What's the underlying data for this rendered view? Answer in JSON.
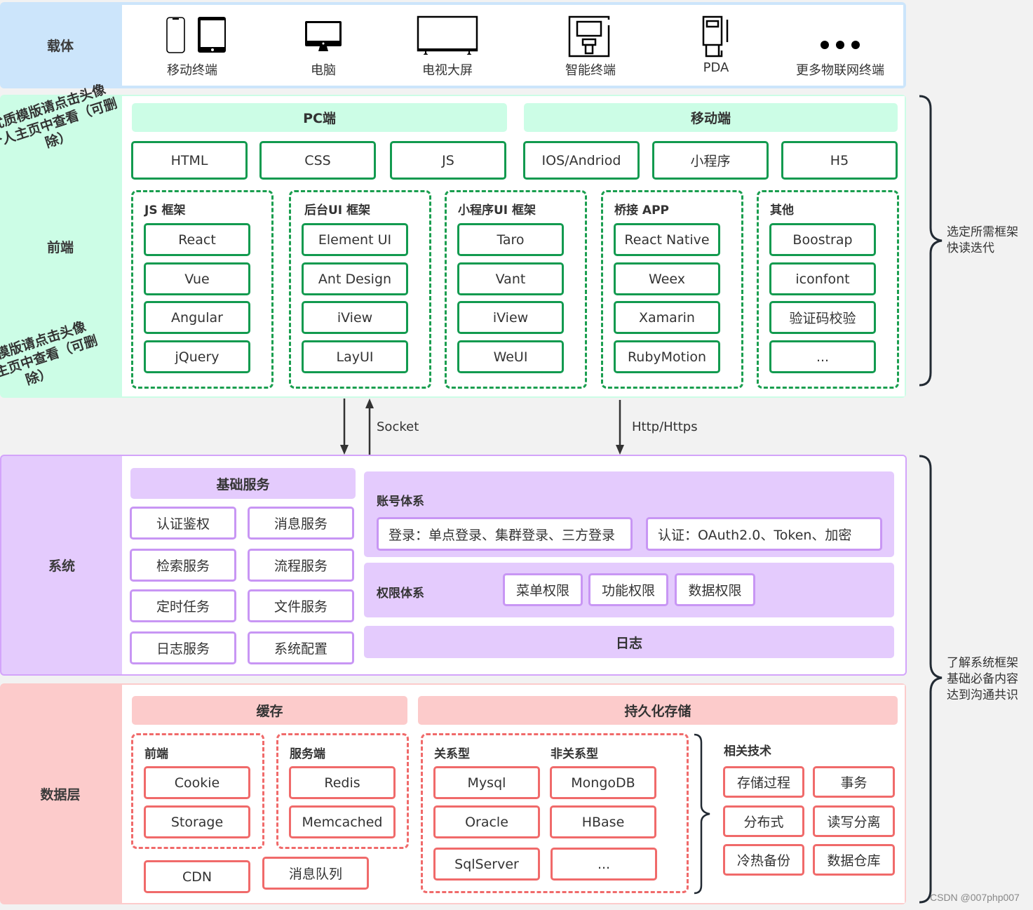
{
  "colors": {
    "carrier_bg": "#cce5fb",
    "frontend_bg": "#ccfde6",
    "system_bg": "#e4cbfd",
    "data_bg": "#fccbcb",
    "green_border": "#129a4f",
    "purple_border": "#c896f4",
    "red_border": "#f06a6a"
  },
  "carrier": {
    "label": "载体",
    "devices": [
      {
        "icon": "mobile-tablet-icon",
        "label": "移动终端"
      },
      {
        "icon": "desktop-computer-icon",
        "label": "电脑"
      },
      {
        "icon": "tv-screen-icon",
        "label": "电视大屏"
      },
      {
        "icon": "smart-terminal-icon",
        "label": "智能终端"
      },
      {
        "icon": "pda-icon",
        "label": "PDA"
      },
      {
        "icon": "more-dots-icon",
        "label": "更多物联网终端"
      }
    ]
  },
  "frontend": {
    "label": "前端",
    "watermark_top": "优质模版请点击头像\n个人主页中查看（可删\n除）",
    "watermark_bottom": "优质模版请点击头像\n个人主页中查看（可删\n除）",
    "pc_header": "PC端",
    "mobile_header": "移动端",
    "pc_items": [
      "HTML",
      "CSS",
      "JS"
    ],
    "mobile_items": [
      "IOS/Andriod",
      "小程序",
      "H5"
    ],
    "groups": [
      {
        "title": "JS 框架",
        "items": [
          "React",
          "Vue",
          "Angular",
          "jQuery"
        ]
      },
      {
        "title": "后台UI 框架",
        "items": [
          "Element UI",
          "Ant Design",
          "iView",
          "LayUI"
        ]
      },
      {
        "title": "小程序UI 框架",
        "items": [
          "Taro",
          "Vant",
          "iView",
          "WeUI"
        ]
      },
      {
        "title": "桥接 APP",
        "items": [
          "React Native",
          "Weex",
          "Xamarin",
          "RubyMotion"
        ]
      },
      {
        "title": "其他",
        "items": [
          "Boostrap",
          "iconfont",
          "验证码校验",
          "..."
        ]
      }
    ],
    "note": "选定所需框架\n快读迭代"
  },
  "arrows": {
    "socket_label": "Socket",
    "http_label": "Http/Https"
  },
  "system": {
    "label": "系统",
    "base_header": "基础服务",
    "base_items": [
      "认证鉴权",
      "消息服务",
      "检索服务",
      "流程服务",
      "定时任务",
      "文件服务",
      "日志服务",
      "系统配置"
    ],
    "account": {
      "title": "账号体系",
      "login": "登录：单点登录、集群登录、三方登录",
      "auth": "认证：OAuth2.0、Token、加密"
    },
    "permission": {
      "title": "权限体系",
      "items": [
        "菜单权限",
        "功能权限",
        "数据权限"
      ]
    },
    "log": "日志"
  },
  "datalayer": {
    "label": "数据层",
    "cache_header": "缓存",
    "persist_header": "持久化存储",
    "cache_frontend": {
      "title": "前端",
      "items": [
        "Cookie",
        "Storage"
      ]
    },
    "cache_server": {
      "title": "服务端",
      "items": [
        "Redis",
        "Memcached"
      ]
    },
    "cache_extra": [
      "CDN",
      "消息队列"
    ],
    "relational": {
      "title": "关系型",
      "items": [
        "Mysql",
        "Oracle",
        "SqlServer"
      ]
    },
    "nonrelational": {
      "title": "非关系型",
      "items": [
        "MongoDB",
        "HBase",
        "..."
      ]
    },
    "related": {
      "title": "相关技术",
      "items": [
        "存储过程",
        "事务",
        "分布式",
        "读写分离",
        "冷热备份",
        "数据仓库"
      ]
    }
  },
  "bottom_note": "了解系统框架\n基础必备内容\n达到沟通共识",
  "watermark": "CSDN @007php007"
}
